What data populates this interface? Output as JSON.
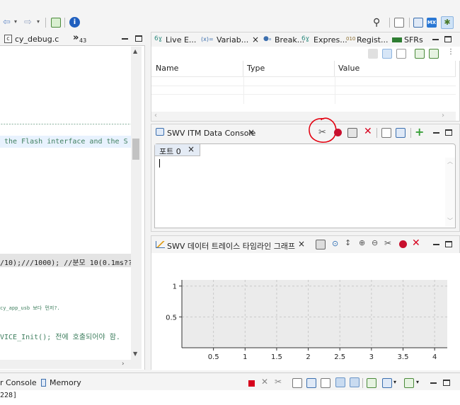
{
  "toolbar": {
    "nav_back": "⇦",
    "nav_forward": "⇨",
    "search_icon": "search-icon"
  },
  "editor": {
    "tab_label": "cy_debug.c",
    "overflow_label": "»",
    "overflow_count": "43",
    "lines": [
      {
        "text": "------------------------------------------------------------------------------------------------"
      },
      {
        "text": " the Flash interface and the S"
      },
      {
        "text": "/10);///1000); //분모 10(0.1ms??"
      },
      {
        "text": "cy_app_usb 보다 먼저?."
      },
      {
        "text": "VICE_Init(); 전에 호출되어야 함."
      }
    ]
  },
  "views_top": {
    "tabs": [
      {
        "label": "Live E..."
      },
      {
        "label": "Variab..."
      },
      {
        "label": "Break..."
      },
      {
        "label": "Expres..."
      },
      {
        "label": "Regist..."
      },
      {
        "label": "SFRs"
      }
    ],
    "columns": [
      "Name",
      "Type",
      "Value"
    ]
  },
  "swv_console": {
    "title": "SWV ITM Data Console",
    "port_tab": "포트 0"
  },
  "swv_graph": {
    "title": "SWV 데이터 트레이스 타임라인 그래프"
  },
  "chart_data": {
    "type": "line",
    "x_ticks": [
      "0.5",
      "1",
      "1.5",
      "2",
      "2.5",
      "3",
      "3.5",
      "4"
    ],
    "y_ticks": [
      "1",
      "0.5"
    ],
    "xlim": [
      0,
      4.2
    ],
    "ylim": [
      0,
      1.1
    ],
    "grid": true,
    "series": []
  },
  "bottom": {
    "tabs": [
      {
        "label": "r Console"
      },
      {
        "label": "Memory"
      }
    ],
    "status_text": "228]"
  },
  "colors": {
    "accent": "#1f6fd1",
    "annotation": "#e3000f",
    "grid_bg": "#ebebeb"
  }
}
